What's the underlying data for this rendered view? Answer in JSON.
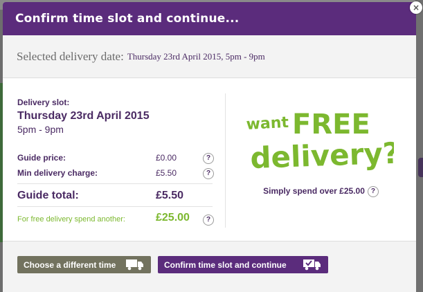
{
  "modal": {
    "title": "Confirm time slot and continue...",
    "close_label": "×"
  },
  "selected": {
    "label": "Selected delivery date:",
    "value": "Thursday 23rd April 2015, 5pm - 9pm"
  },
  "slot": {
    "label": "Delivery slot:",
    "date": "Thursday 23rd April 2015",
    "time": "5pm - 9pm"
  },
  "prices": {
    "guide_price_label": "Guide price:",
    "guide_price_value": "£0.00",
    "min_charge_label": "Min delivery charge:",
    "min_charge_value": "£5.50",
    "guide_total_label": "Guide total:",
    "guide_total_value": "£5.50",
    "free_spend_label": "For free delivery spend another:",
    "free_spend_value": "£25.00",
    "help_glyph": "?"
  },
  "promo": {
    "headline_want": "want",
    "headline_free": "FREE",
    "headline_delivery": "delivery?",
    "text": "Simply spend over £25.00"
  },
  "buttons": {
    "choose_different": "Choose a different time",
    "confirm": "Confirm time slot and continue"
  },
  "colors": {
    "brand_purple": "#5b2c7c",
    "text_purple": "#4a2a63",
    "free_green": "#7cb82f",
    "grey_button": "#72725e"
  },
  "icons": {
    "truck": "truck-icon",
    "truck_check": "truck-check-icon",
    "help": "help-icon",
    "close": "close-icon"
  }
}
